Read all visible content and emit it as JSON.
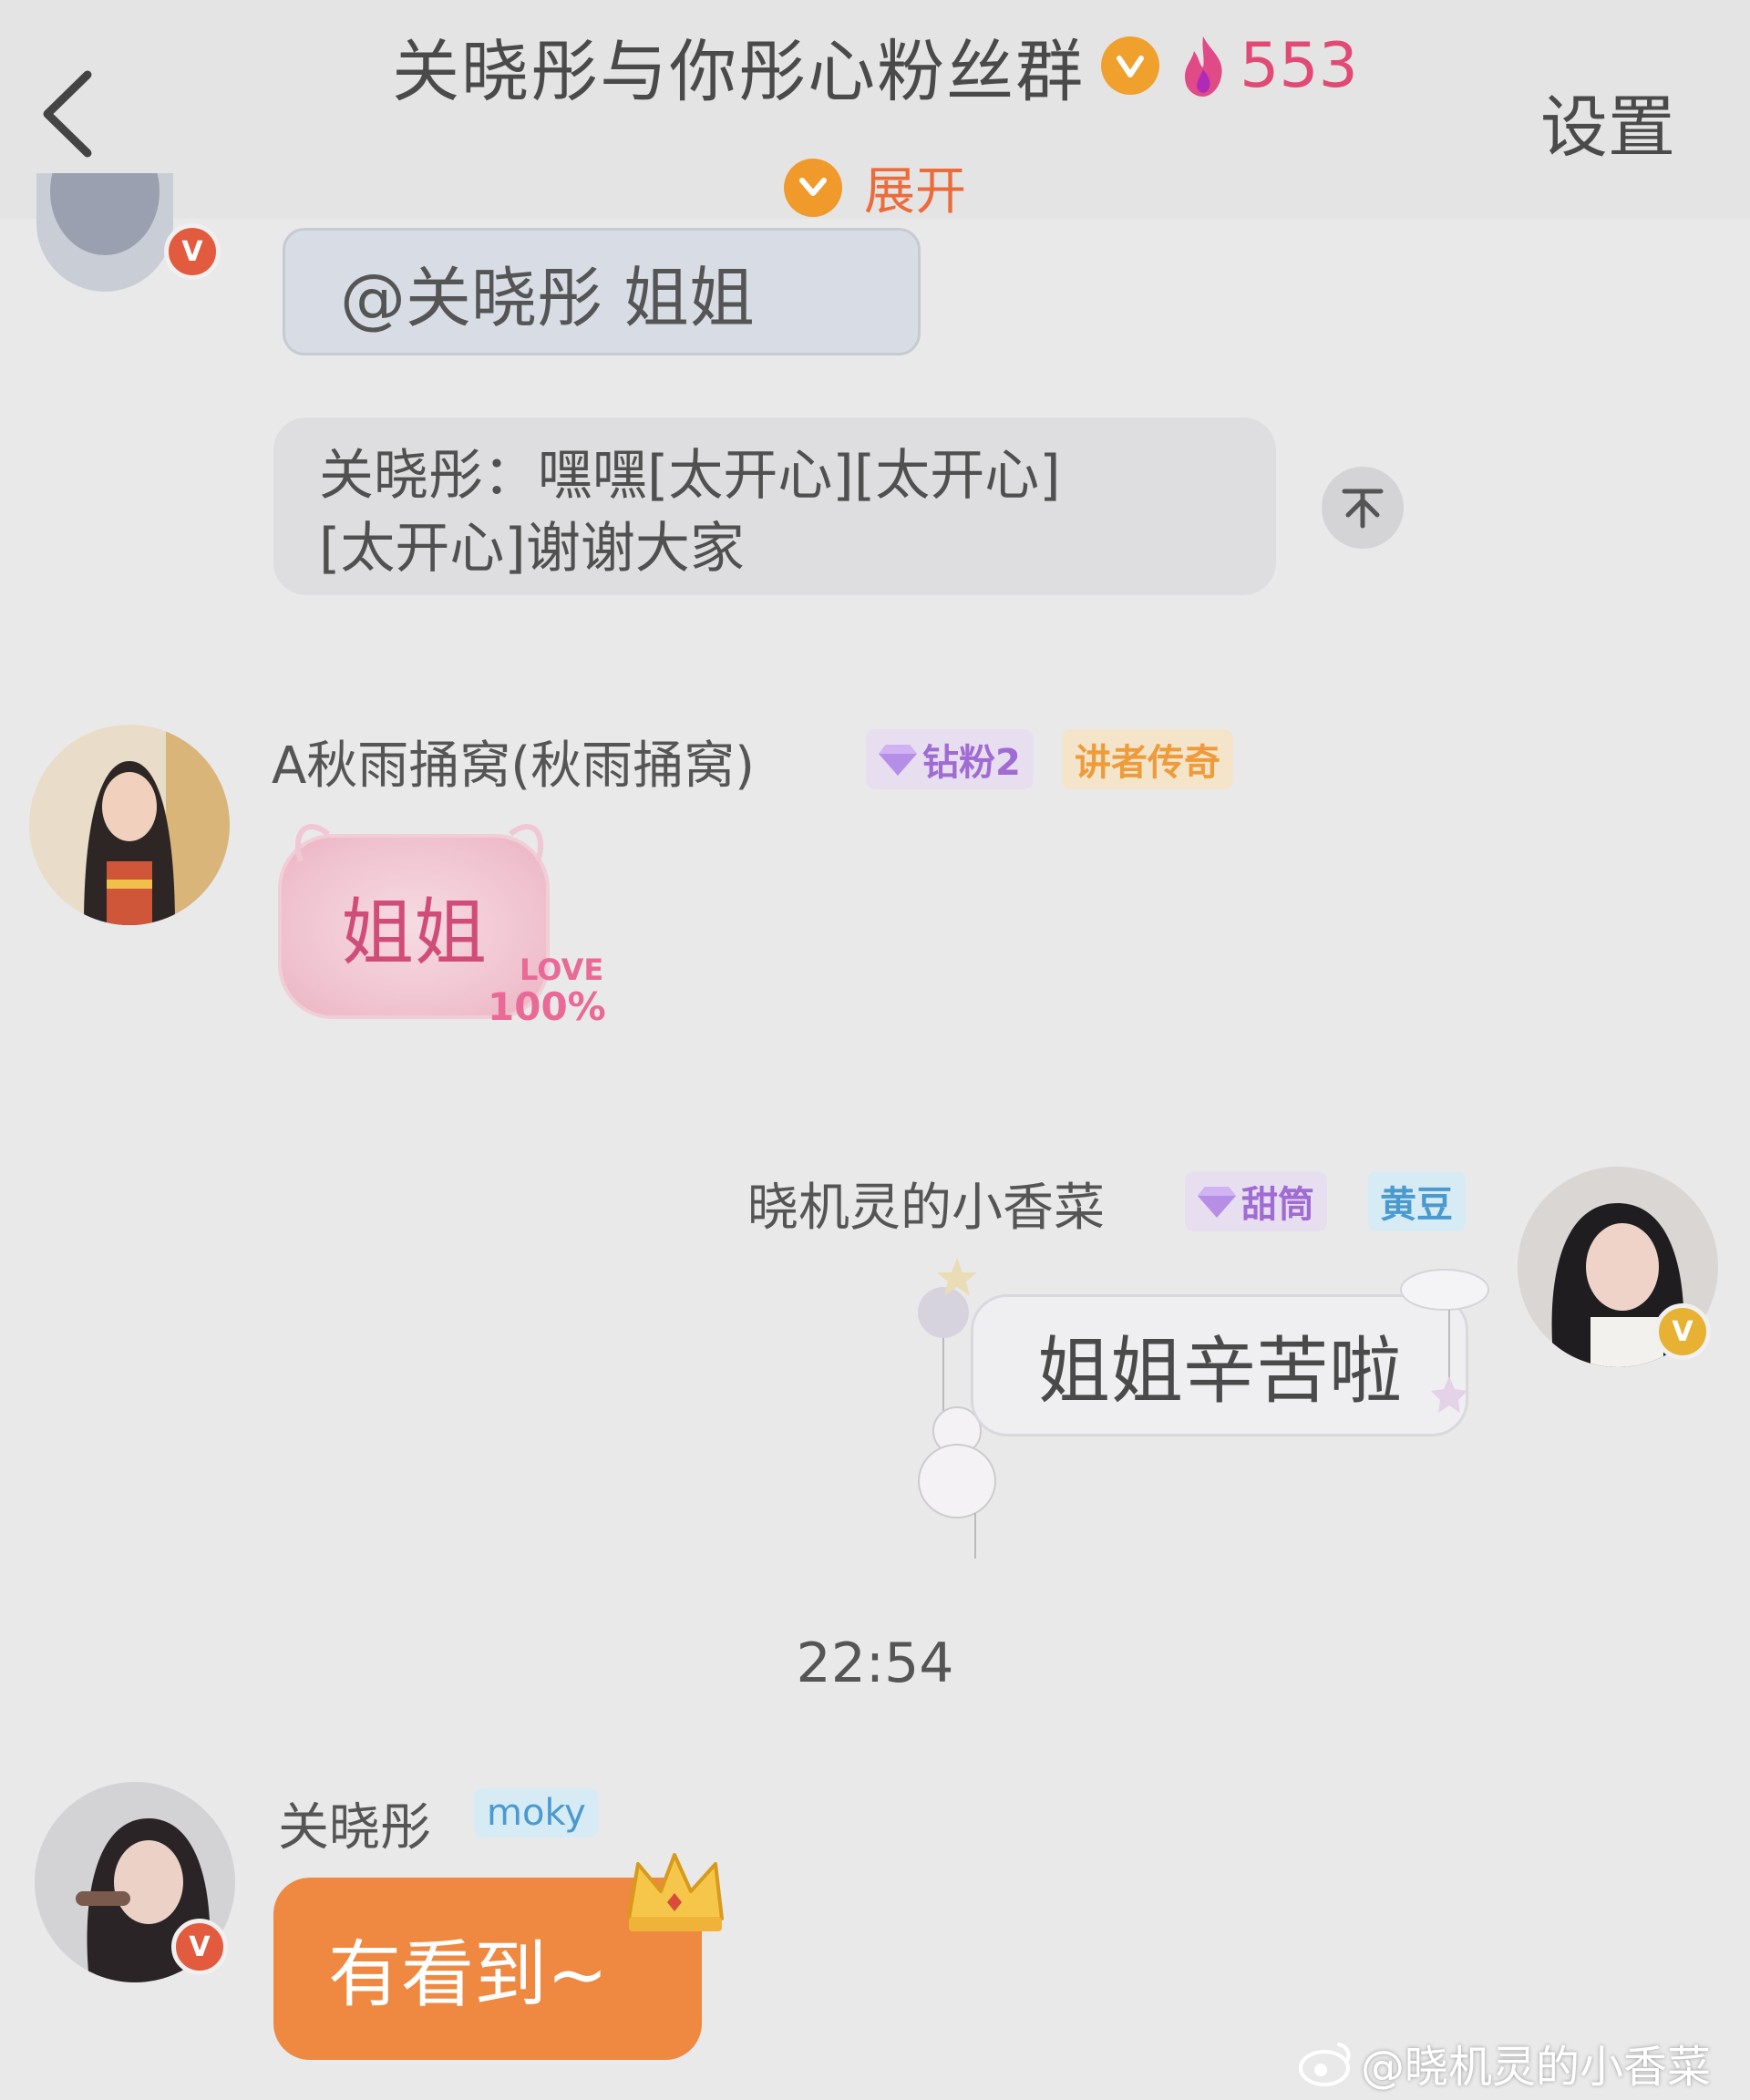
{
  "header": {
    "title": "关晓彤与你彤心粉丝群",
    "member_count": "553",
    "settings_label": "设置",
    "expand_label": "展开"
  },
  "messages": {
    "mention": {
      "text": "@关晓彤 姐姐"
    },
    "pinned": {
      "line1": "关晓彤：嘿嘿[太开心][太开心]",
      "line2": "[太开心]谢谢大家"
    },
    "msg1": {
      "sender": "A秋雨捅窝(秋雨捅窝)",
      "fan_tag": "钻粉2",
      "title_tag": "讲者传奇",
      "sticker_text": "姐姐",
      "sticker_love": "LOVE",
      "sticker_pct": "100%"
    },
    "msg2": {
      "sender": "晓机灵的小香菜",
      "fan_tag": "甜筒",
      "title_tag": "黄豆",
      "sticker_text": "姐姐辛苦啦"
    },
    "time": "22:54",
    "msg3": {
      "sender": "关晓彤",
      "tag": "moky",
      "text": "有看到~"
    }
  },
  "watermark": "@晓机灵的小香菜",
  "colors": {
    "accent_orange": "#ef8840",
    "badge_gold": "#f0a12d",
    "count_pink": "#e14a75",
    "tag_purple": "#a16bd4"
  },
  "icons": [
    "back-arrow-icon",
    "v-badge-icon",
    "fire-icon",
    "chevron-down-icon",
    "pin-top-icon",
    "diamond-icon",
    "crown-icon",
    "weibo-icon"
  ]
}
